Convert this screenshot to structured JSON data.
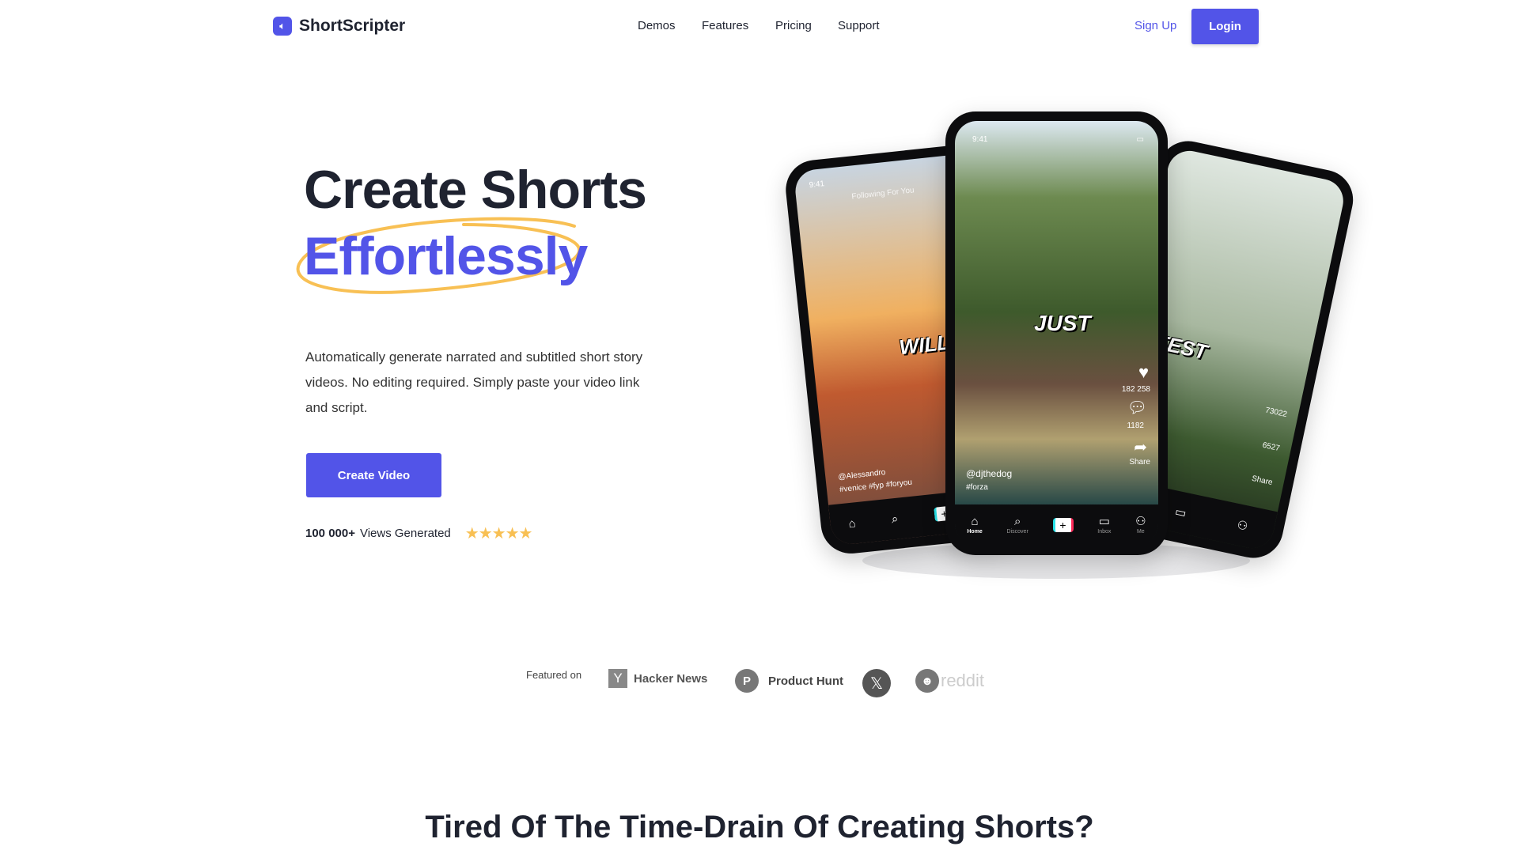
{
  "header": {
    "brand": "ShortScripter",
    "logo_icon": "speaker-icon",
    "nav": [
      "Demos",
      "Features",
      "Pricing",
      "Support"
    ],
    "signup": "Sign Up",
    "login": "Login"
  },
  "hero": {
    "title_line1": "Create Shorts",
    "title_line2": "Effortlessly",
    "description": "Automatically generate narrated and subtitled short story videos. No editing required. Simply paste your video link and script.",
    "cta": "Create Video",
    "views_count": "100 000+",
    "views_label": "Views Generated",
    "rating_stars": 5
  },
  "phones": {
    "left": {
      "time": "9:41",
      "tabs_top": "Following  For You",
      "caption": "WILL",
      "user": "@Alessandro",
      "tags": "#venice #fyp #foryou"
    },
    "center": {
      "time": "9:41",
      "caption": "JUST",
      "likes": "182 258",
      "comments": "1182",
      "share": "Share",
      "user": "@djthedog",
      "tags": "#forza",
      "tabs": [
        "Home",
        "Discover",
        "Inbox",
        "Me"
      ]
    },
    "right": {
      "caption": "EATEST",
      "likes": "73022",
      "comments": "6527",
      "share": "Share"
    }
  },
  "featured": {
    "label": "Featured on",
    "items": [
      "Hacker News",
      "Product Hunt",
      "X",
      "reddit"
    ]
  },
  "section2": {
    "title": "Tired Of The Time-Drain Of Creating Shorts?"
  },
  "colors": {
    "accent": "#5254e8",
    "highlight": "#f8c054",
    "text": "#1f2330"
  }
}
